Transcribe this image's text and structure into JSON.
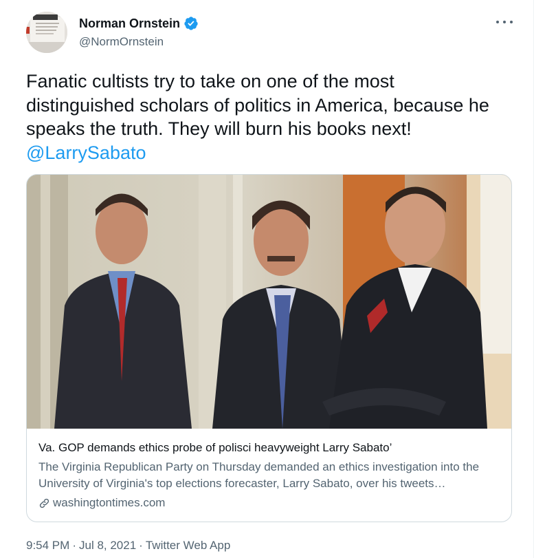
{
  "author": {
    "display_name": "Norman Ornstein",
    "handle": "@NormOrnstein",
    "verified_icon": "verified-badge-icon"
  },
  "tweet": {
    "text": "Fanatic cultists try to take on one of the most distinguished scholars of politics in America, because he speaks the truth. They will burn his books next!",
    "mention": "@LarrySabato"
  },
  "card": {
    "title": "Va. GOP demands ethics probe of polisci heavyweight Larry Sabato’",
    "description": "The Virginia Republican Party on Thursday demanded an ethics investigation into the University of Virginia's top elections forecaster, Larry Sabato, over his tweets…",
    "domain": "washingtontimes.com",
    "domain_icon": "link-icon"
  },
  "meta": {
    "time": "9:54 PM",
    "date": "Jul 8, 2021",
    "source": "Twitter Web App"
  },
  "colors": {
    "accent": "#1d9bf0",
    "text": "#0f1419",
    "secondary": "#536471",
    "border": "#cfd9de"
  }
}
